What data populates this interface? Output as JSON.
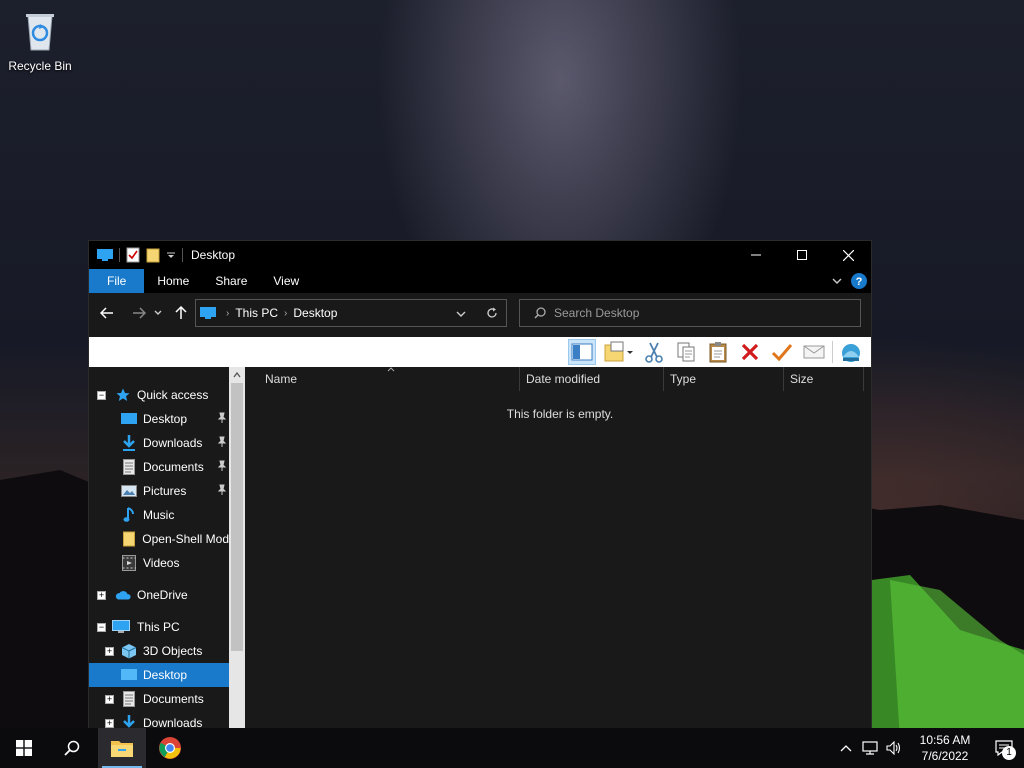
{
  "desktop": {
    "icons": [
      {
        "label": "Recycle Bin",
        "icon": "recycle-bin-icon"
      }
    ]
  },
  "window": {
    "title": "Desktop",
    "ribbon_tabs": [
      {
        "label": "File",
        "active": true
      },
      {
        "label": "Home"
      },
      {
        "label": "Share"
      },
      {
        "label": "View"
      }
    ],
    "address": {
      "crumbs": [
        "This PC",
        "Desktop"
      ]
    },
    "search": {
      "placeholder": "Search Desktop"
    },
    "columns": [
      "Name",
      "Date modified",
      "Type",
      "Size"
    ],
    "empty_text": "This folder is empty.",
    "nav": {
      "quick_access": {
        "label": "Quick access",
        "items": [
          {
            "label": "Desktop",
            "pinned": true
          },
          {
            "label": "Downloads",
            "pinned": true
          },
          {
            "label": "Documents",
            "pinned": true
          },
          {
            "label": "Pictures",
            "pinned": true
          },
          {
            "label": "Music"
          },
          {
            "label": "Open-Shell Mod"
          },
          {
            "label": "Videos"
          }
        ]
      },
      "onedrive": {
        "label": "OneDrive"
      },
      "this_pc": {
        "label": "This PC",
        "items": [
          {
            "label": "3D Objects"
          },
          {
            "label": "Desktop",
            "selected": true
          },
          {
            "label": "Documents"
          },
          {
            "label": "Downloads"
          }
        ]
      }
    }
  },
  "taskbar": {
    "clock_time": "10:56 AM",
    "clock_date": "7/6/2022",
    "notification_count": "1"
  },
  "colors": {
    "accent": "#1979ca",
    "window_bg": "#191919",
    "title_bg": "#000000"
  }
}
